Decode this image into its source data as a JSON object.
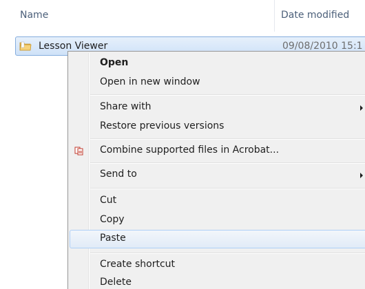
{
  "columns": {
    "name": "Name",
    "date_modified": "Date modified"
  },
  "file": {
    "name": "Lesson Viewer",
    "date": "09/08/2010 15:1",
    "icon": "folder-icon"
  },
  "menu": {
    "items": [
      {
        "label": "Open",
        "bold": true
      },
      {
        "label": "Open in new window"
      },
      {
        "label": "Share with",
        "submenu": true
      },
      {
        "label": "Restore previous versions"
      },
      {
        "label": "Combine supported files in Acrobat...",
        "icon": "acrobat-icon"
      },
      {
        "label": "Send to",
        "submenu": true
      },
      {
        "label": "Cut"
      },
      {
        "label": "Copy"
      },
      {
        "label": "Paste",
        "highlighted": true
      },
      {
        "label": "Create shortcut"
      },
      {
        "label": "Delete"
      }
    ]
  },
  "colors": {
    "header_text": "#4c607a",
    "selection_border": "#84acdd",
    "menu_bg": "#f0f0f0"
  }
}
